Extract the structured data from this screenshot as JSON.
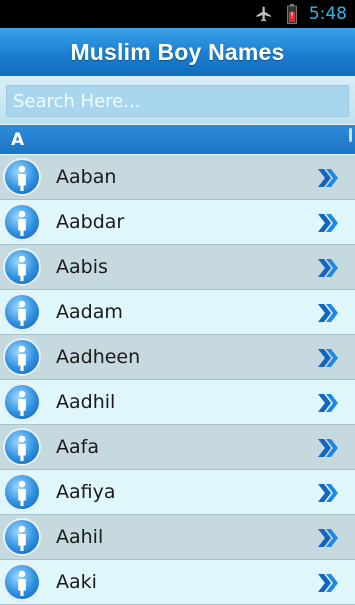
{
  "status_bar": {
    "time": "5:48",
    "icons": [
      "airplane-mode-icon",
      "battery-low-icon"
    ]
  },
  "header": {
    "title": "Muslim Boy Names"
  },
  "search": {
    "placeholder": "Search Here..."
  },
  "section": {
    "letter": "A"
  },
  "names": [
    {
      "label": "Aaban"
    },
    {
      "label": "Aabdar"
    },
    {
      "label": "Aabis"
    },
    {
      "label": "Aadam"
    },
    {
      "label": "Aadheen"
    },
    {
      "label": "Aadhil"
    },
    {
      "label": "Aafa"
    },
    {
      "label": "Aafiya"
    },
    {
      "label": "Aahil"
    },
    {
      "label": "Aaki"
    }
  ],
  "colors": {
    "accent": "#1b7fd0",
    "row_odd": "#c6d9de",
    "row_even": "#dff6fb",
    "chevron": "#1565c0"
  }
}
